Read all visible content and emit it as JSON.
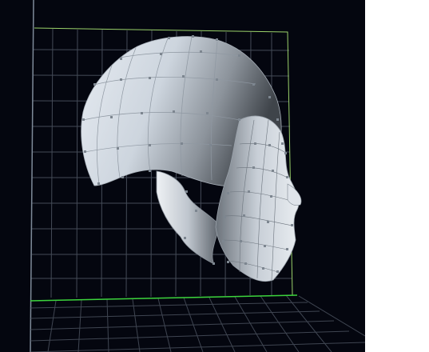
{
  "viewport": {
    "background": "#04060f",
    "grid_color": "#5a6270",
    "axis_x_color": "#3cd43c",
    "axis_y_color": "#9ad16a",
    "mesh_color": "#c9d2dc",
    "vertex_color": "#7d8690",
    "model": "head-mesh",
    "view": "perspective-side"
  }
}
